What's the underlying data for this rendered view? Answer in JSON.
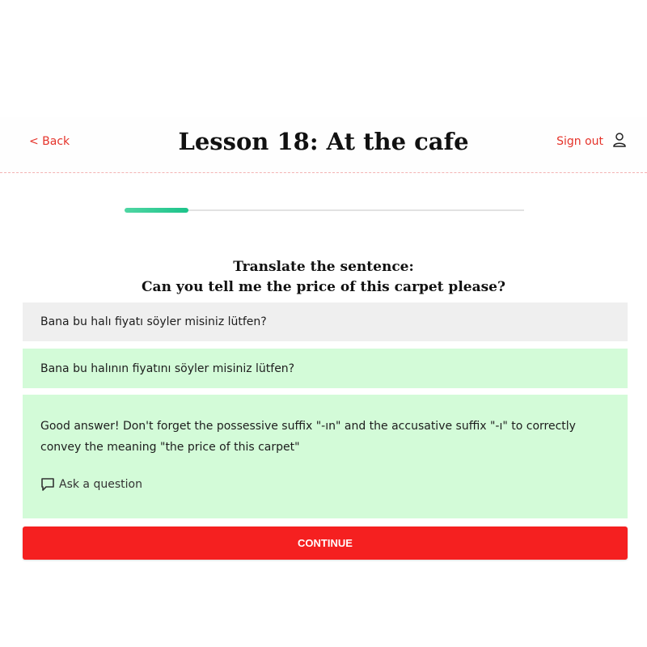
{
  "header": {
    "back_label": "< Back",
    "title": "Lesson 18: At the cafe",
    "signout_label": "Sign out",
    "user_icon": "user-icon"
  },
  "progress": {
    "fraction": 0.16,
    "fill_color": "#1cc38a",
    "track_color": "#e2e2e2"
  },
  "prompt": {
    "line1": "Translate the sentence:",
    "line2": "Can you tell me the price of this carpet please?"
  },
  "answers": {
    "user_answer": "Bana bu halı fiyatı söyler misiniz lütfen?",
    "correct_answer": "Bana bu halının fiyatını söyler misiniz lütfen?"
  },
  "feedback": {
    "text": "Good answer! Don't forget the possessive suffix \"-ın\" and the accusative suffix \"-ı\" to correctly convey the meaning \"the price of this carpet\"",
    "ask_label": "Ask a question",
    "ask_icon": "speech-bubble-icon"
  },
  "actions": {
    "continue_label": "CONTINUE"
  },
  "colors": {
    "accent_red": "#f52020",
    "link_red": "#e5332a",
    "success_green_bg": "#d3fbd8",
    "neutral_bg": "#efefef"
  }
}
